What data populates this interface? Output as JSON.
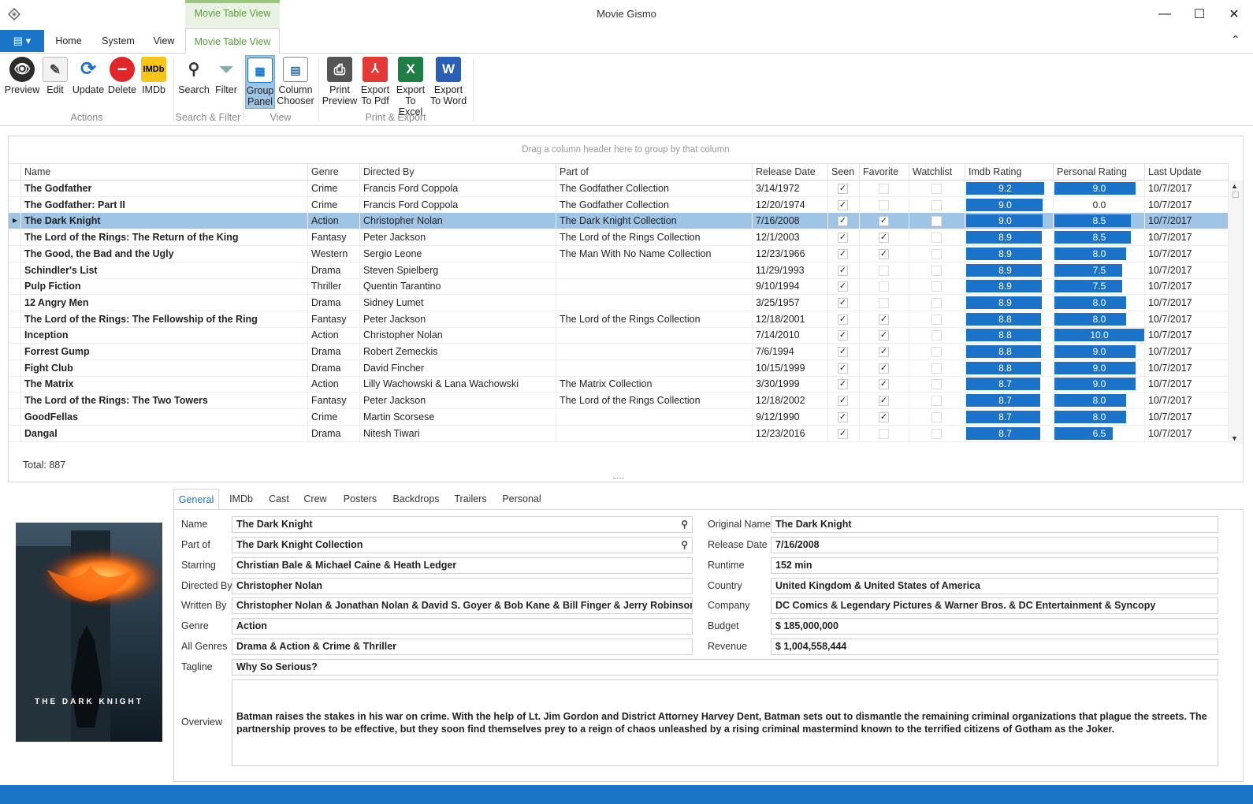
{
  "window": {
    "title": "Movie Gismo",
    "minimize": "—",
    "maximize": "☐",
    "close": "✕",
    "collapse": "⌃"
  },
  "ribbon_tabs": {
    "home": "Home",
    "system": "System",
    "view": "View",
    "context_header": "Movie Table View",
    "context_tab": "Movie Table View"
  },
  "ribbon": {
    "actions": {
      "label": "Actions",
      "preview": "Preview",
      "edit": "Edit",
      "update": "Update",
      "delete": "Delete",
      "imdb": "IMDb"
    },
    "search_filter": {
      "label": "Search & Filter",
      "search": "Search",
      "filter": "Filter"
    },
    "view": {
      "label": "View",
      "group_panel_1": "Group",
      "group_panel_2": "Panel",
      "column_chooser_1": "Column",
      "column_chooser_2": "Chooser"
    },
    "print_export": {
      "label": "Print & Export",
      "print_1": "Print",
      "print_2": "Preview",
      "pdf_1": "Export",
      "pdf_2": "To Pdf",
      "excel_1": "Export",
      "excel_2": "To Excel",
      "word_1": "Export",
      "word_2": "To Word"
    }
  },
  "grid": {
    "group_panel_text": "Drag a column header here to group by that column",
    "columns": [
      "Name",
      "Genre",
      "Directed By",
      "Part of",
      "Release Date",
      "Seen",
      "Favorite",
      "Watchlist",
      "Imdb Rating",
      "Personal Rating",
      "Last Update"
    ],
    "rows": [
      {
        "name": "The Godfather",
        "genre": "Crime",
        "director": "Francis Ford Coppola",
        "part_of": "The Godfather Collection",
        "release": "3/14/1972",
        "seen": true,
        "favorite": false,
        "watchlist": false,
        "imdb": 9.2,
        "personal": 9.0,
        "personal_label": "9.0",
        "updated": "10/7/2017"
      },
      {
        "name": "The Godfather: Part II",
        "genre": "Crime",
        "director": "Francis Ford Coppola",
        "part_of": "The Godfather Collection",
        "release": "12/20/1974",
        "seen": true,
        "favorite": false,
        "watchlist": false,
        "imdb": 9.0,
        "personal": 0,
        "personal_label": "0.0",
        "updated": "10/7/2017"
      },
      {
        "name": "The Dark Knight",
        "genre": "Action",
        "director": "Christopher Nolan",
        "part_of": "The Dark Knight Collection",
        "release": "7/16/2008",
        "seen": true,
        "favorite": true,
        "watchlist": false,
        "imdb": 9.0,
        "personal": 8.5,
        "personal_label": "8.5",
        "updated": "10/7/2017",
        "selected": true
      },
      {
        "name": "The Lord of the Rings: The Return of the King",
        "genre": "Fantasy",
        "director": "Peter Jackson",
        "part_of": "The Lord of the Rings Collection",
        "release": "12/1/2003",
        "seen": true,
        "favorite": true,
        "watchlist": false,
        "imdb": 8.9,
        "personal": 8.5,
        "personal_label": "8.5",
        "updated": "10/7/2017"
      },
      {
        "name": "The Good, the Bad and the Ugly",
        "genre": "Western",
        "director": "Sergio Leone",
        "part_of": "The Man With No Name Collection",
        "release": "12/23/1966",
        "seen": true,
        "favorite": true,
        "watchlist": false,
        "imdb": 8.9,
        "personal": 8.0,
        "personal_label": "8.0",
        "updated": "10/7/2017"
      },
      {
        "name": "Schindler's List",
        "genre": "Drama",
        "director": "Steven Spielberg",
        "part_of": "",
        "release": "11/29/1993",
        "seen": true,
        "favorite": false,
        "watchlist": false,
        "imdb": 8.9,
        "personal": 7.5,
        "personal_label": "7.5",
        "updated": "10/7/2017"
      },
      {
        "name": "Pulp Fiction",
        "genre": "Thriller",
        "director": "Quentin Tarantino",
        "part_of": "",
        "release": "9/10/1994",
        "seen": true,
        "favorite": false,
        "watchlist": false,
        "imdb": 8.9,
        "personal": 7.5,
        "personal_label": "7.5",
        "updated": "10/7/2017"
      },
      {
        "name": "12 Angry Men",
        "genre": "Drama",
        "director": "Sidney Lumet",
        "part_of": "",
        "release": "3/25/1957",
        "seen": true,
        "favorite": false,
        "watchlist": false,
        "imdb": 8.9,
        "personal": 8.0,
        "personal_label": "8.0",
        "updated": "10/7/2017"
      },
      {
        "name": "The Lord of the Rings: The Fellowship of the Ring",
        "genre": "Fantasy",
        "director": "Peter Jackson",
        "part_of": "The Lord of the Rings Collection",
        "release": "12/18/2001",
        "seen": true,
        "favorite": true,
        "watchlist": false,
        "imdb": 8.8,
        "personal": 8.0,
        "personal_label": "8.0",
        "updated": "10/7/2017"
      },
      {
        "name": "Inception",
        "genre": "Action",
        "director": "Christopher Nolan",
        "part_of": "",
        "release": "7/14/2010",
        "seen": true,
        "favorite": true,
        "watchlist": false,
        "imdb": 8.8,
        "personal": 10.0,
        "personal_label": "10.0",
        "updated": "10/7/2017"
      },
      {
        "name": "Forrest Gump",
        "genre": "Drama",
        "director": "Robert Zemeckis",
        "part_of": "",
        "release": "7/6/1994",
        "seen": true,
        "favorite": true,
        "watchlist": false,
        "imdb": 8.8,
        "personal": 9.0,
        "personal_label": "9.0",
        "updated": "10/7/2017"
      },
      {
        "name": "Fight Club",
        "genre": "Drama",
        "director": "David Fincher",
        "part_of": "",
        "release": "10/15/1999",
        "seen": true,
        "favorite": true,
        "watchlist": false,
        "imdb": 8.8,
        "personal": 9.0,
        "personal_label": "9.0",
        "updated": "10/7/2017"
      },
      {
        "name": "The Matrix",
        "genre": "Action",
        "director": "Lilly Wachowski & Lana Wachowski",
        "part_of": "The Matrix Collection",
        "release": "3/30/1999",
        "seen": true,
        "favorite": true,
        "watchlist": false,
        "imdb": 8.7,
        "personal": 9.0,
        "personal_label": "9.0",
        "updated": "10/7/2017"
      },
      {
        "name": "The Lord of the Rings: The Two Towers",
        "genre": "Fantasy",
        "director": "Peter Jackson",
        "part_of": "The Lord of the Rings Collection",
        "release": "12/18/2002",
        "seen": true,
        "favorite": true,
        "watchlist": false,
        "imdb": 8.7,
        "personal": 8.0,
        "personal_label": "8.0",
        "updated": "10/7/2017"
      },
      {
        "name": "GoodFellas",
        "genre": "Crime",
        "director": "Martin Scorsese",
        "part_of": "",
        "release": "9/12/1990",
        "seen": true,
        "favorite": true,
        "watchlist": false,
        "imdb": 8.7,
        "personal": 8.0,
        "personal_label": "8.0",
        "updated": "10/7/2017"
      },
      {
        "name": "Dangal",
        "genre": "Drama",
        "director": "Nitesh Tiwari",
        "part_of": "",
        "release": "12/23/2016",
        "seen": true,
        "favorite": false,
        "watchlist": false,
        "imdb": 8.7,
        "personal": 6.5,
        "personal_label": "6.5",
        "updated": "10/7/2017"
      }
    ],
    "total": "Total: 887"
  },
  "detail": {
    "tabs": [
      "General",
      "IMDb",
      "Cast",
      "Crew",
      "Posters",
      "Backdrops",
      "Trailers",
      "Personal"
    ],
    "poster_text": "THE DARK KNIGHT",
    "fields": {
      "name": {
        "label": "Name",
        "value": "The Dark Knight"
      },
      "part_of": {
        "label": "Part of",
        "value": "The Dark Knight Collection"
      },
      "starring": {
        "label": "Starring",
        "value": "Christian Bale & Michael Caine & Heath Ledger"
      },
      "directed_by": {
        "label": "Directed By",
        "value": "Christopher Nolan"
      },
      "written_by": {
        "label": "Written By",
        "value": "Christopher Nolan & Jonathan Nolan & David S. Goyer & Bob Kane & Bill Finger & Jerry Robinson"
      },
      "genre": {
        "label": "Genre",
        "value": "Action"
      },
      "all_genres": {
        "label": "All Genres",
        "value": "Drama & Action & Crime & Thriller"
      },
      "tagline": {
        "label": "Tagline",
        "value": "Why So Serious?"
      },
      "overview": {
        "label": "Overview",
        "value": "Batman raises the stakes in his war on crime. With the help of Lt. Jim Gordon and District Attorney Harvey Dent, Batman sets out to dismantle the remaining criminal organizations that plague the streets. The partnership proves to be effective, but they soon find themselves prey to a reign of chaos unleashed by a rising criminal mastermind known to the terrified citizens of Gotham as the Joker."
      },
      "original_name": {
        "label": "Original Name",
        "value": "The Dark Knight"
      },
      "release_date": {
        "label": "Release Date",
        "value": "7/16/2008"
      },
      "runtime": {
        "label": "Runtime",
        "value": "152 min"
      },
      "country": {
        "label": "Country",
        "value": "United Kingdom & United States of America"
      },
      "company": {
        "label": "Company",
        "value": "DC Comics & Legendary Pictures & Warner Bros. & DC Entertainment & Syncopy"
      },
      "budget": {
        "label": "Budget",
        "value": "$ 185,000,000"
      },
      "revenue": {
        "label": "Revenue",
        "value": "$ 1,004,558,444"
      }
    }
  },
  "colors": {
    "accent": "#1a75c9",
    "selection": "#9ec4e6",
    "rating_bar": "#1a73c8",
    "context_tab": "#5a9a3a"
  }
}
